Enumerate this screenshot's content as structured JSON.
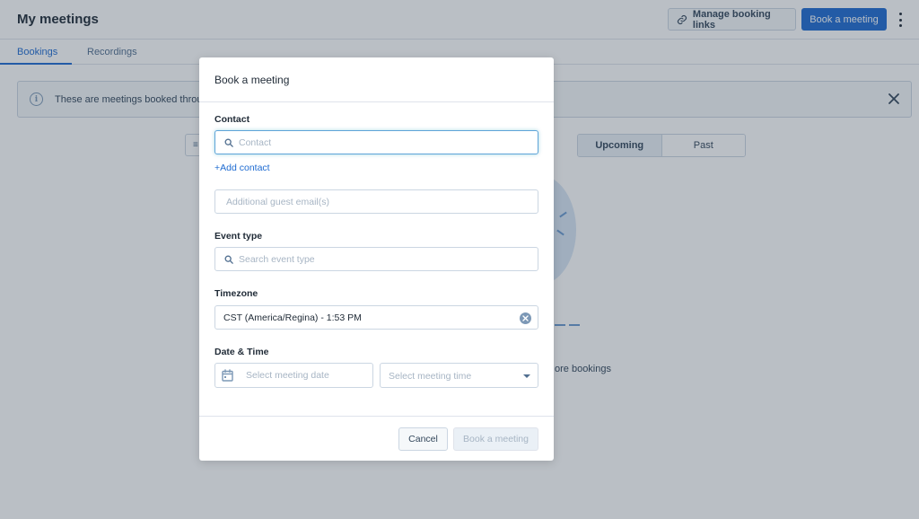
{
  "header": {
    "title": "My meetings",
    "manage_links_label": "Manage booking links",
    "book_meeting_label": "Book a meeting",
    "link_icon": "link-icon",
    "more_icon": "vertical-ellipsis-icon"
  },
  "tabs": [
    {
      "label": "Bookings",
      "active": true
    },
    {
      "label": "Recordings",
      "active": false
    }
  ],
  "banner": {
    "text": "These are meetings booked throug",
    "info_icon_glyph": "i",
    "close_icon": "close-icon"
  },
  "filter": {
    "toggle": [
      {
        "label": "Upcoming",
        "active": true
      },
      {
        "label": "Past",
        "active": false
      }
    ]
  },
  "empty_state": {
    "text": "ore bookings"
  },
  "modal": {
    "title": "Book a meeting",
    "contact": {
      "label": "Contact",
      "placeholder": "Contact",
      "value": ""
    },
    "add_contact_label": "+Add contact",
    "guests": {
      "placeholder": "Additional guest email(s)",
      "value": ""
    },
    "event_type": {
      "label": "Event type",
      "placeholder": "Search event type",
      "value": ""
    },
    "timezone": {
      "label": "Timezone",
      "value": "CST (America/Regina) - 1:53 PM"
    },
    "datetime": {
      "label": "Date & Time",
      "date_placeholder": "Select meeting date",
      "time_placeholder": "Select meeting time"
    },
    "footer": {
      "cancel_label": "Cancel",
      "submit_label": "Book a meeting",
      "submit_disabled": true
    }
  },
  "colors": {
    "primary": "#1e6bd1",
    "text": "#33475b",
    "border": "#cbd6e2",
    "focus": "#5fa4d8",
    "overlay": "rgba(45,62,80,0.33)"
  }
}
